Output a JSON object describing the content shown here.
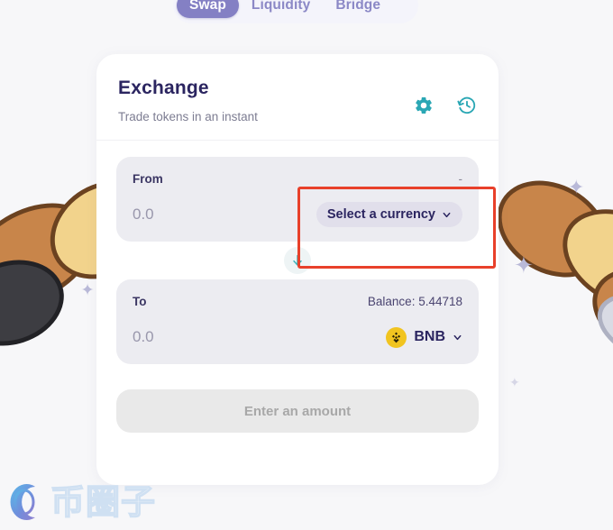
{
  "tabs": [
    {
      "label": "Swap",
      "active": true
    },
    {
      "label": "Liquidity",
      "active": false
    },
    {
      "label": "Bridge",
      "active": false
    }
  ],
  "card": {
    "title": "Exchange",
    "subtitle": "Trade tokens in an instant",
    "settings_icon": "gear-icon",
    "history_icon": "history-icon"
  },
  "from_panel": {
    "label": "From",
    "balance": "-",
    "amount": "0.0",
    "currency_label": "Select a currency",
    "chevron": "chevron-down-icon"
  },
  "swap_button": {
    "icon": "arrow-down-icon"
  },
  "to_panel": {
    "label": "To",
    "balance": "Balance: 5.44718",
    "amount": "0.0",
    "currency_label": "BNB",
    "token_icon": "bnb-logo-icon",
    "chevron": "chevron-down-icon"
  },
  "cta": {
    "label": "Enter an amount",
    "disabled": true
  },
  "annotation": {
    "shape": "rectangle",
    "color": "#e8402a",
    "target": "select-a-currency-button"
  },
  "watermark": {
    "text": "币圈子",
    "logo": "swirl-logo-icon"
  },
  "colors": {
    "accent_purple": "#8480c4",
    "accent_teal": "#2aa7b4",
    "title_navy": "#2b2560",
    "panel_bg": "#ececf1",
    "bnb_yellow": "#f1c420",
    "annotation_red": "#e8402a"
  }
}
